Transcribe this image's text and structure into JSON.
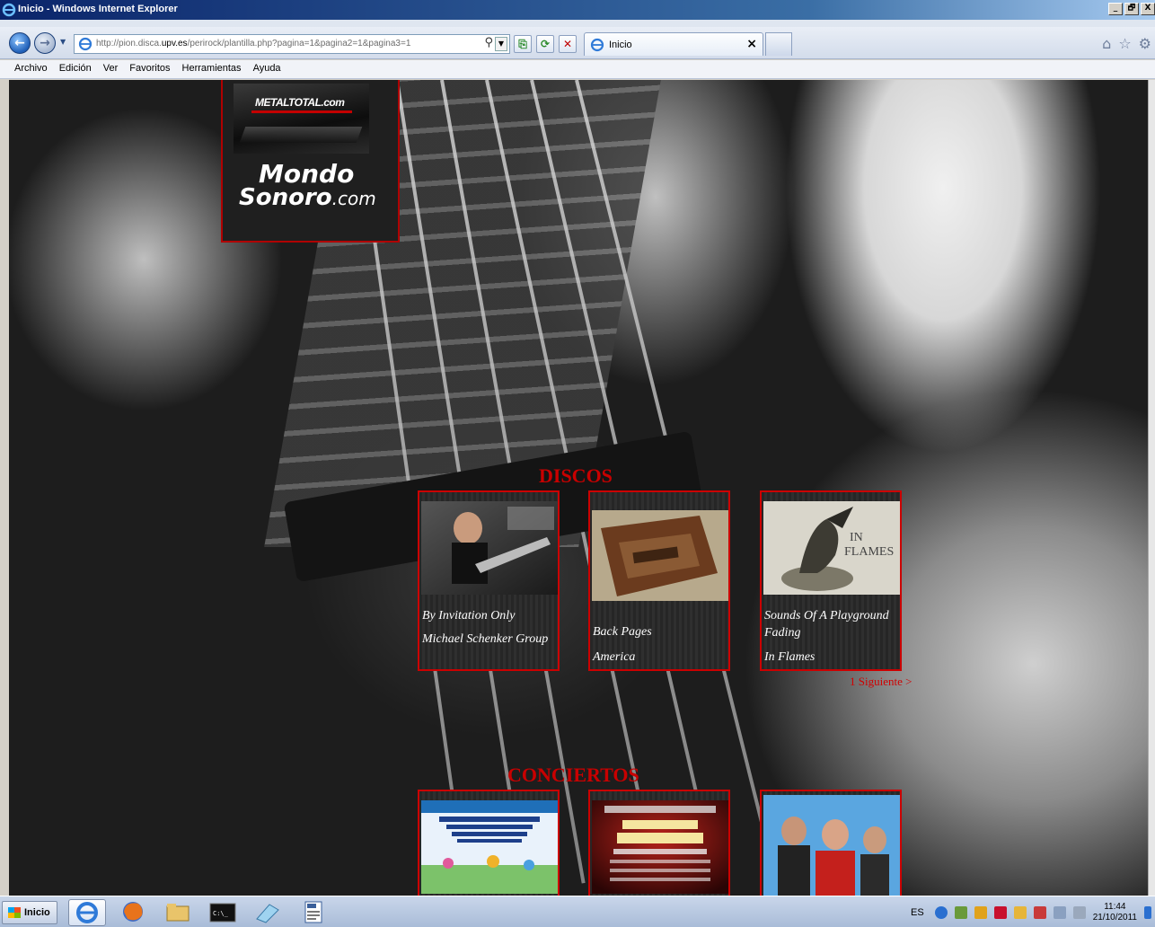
{
  "window": {
    "title": "Inicio - Windows Internet Explorer",
    "buttons": [
      "_",
      "🗗",
      "X"
    ]
  },
  "nav": {
    "back": "←",
    "forward": "→",
    "address_prefix": "http://pion.disca.",
    "address_domain": "upv.es",
    "address_rest": "/perirock/plantilla.php?pagina=1&pagina2=1&pagina3=1",
    "search_symbol": "⚲",
    "tab_label": "Inicio",
    "tab_close": "×"
  },
  "menu": {
    "items": [
      "Archivo",
      "Edición",
      "Ver",
      "Favoritos",
      "Herramientas",
      "Ayuda"
    ]
  },
  "links_panel": {
    "metal_total": "METALTOTAL.com",
    "mondo_line1": "Mondo",
    "mondo_line2": "Sonoro",
    "mondo_com": ".com"
  },
  "discos": {
    "title": "DISCOS",
    "cards": [
      {
        "album": "By Invitation Only",
        "artist": "Michael Schenker Group"
      },
      {
        "album": "Back Pages",
        "artist": "America"
      },
      {
        "album": "Sounds Of A Playground Fading",
        "artist": "In Flames"
      }
    ],
    "pagination": "1 Siguiente >"
  },
  "conciertos": {
    "title": "CONCIERTOS"
  },
  "taskbar": {
    "start_label": "Inicio",
    "lang": "ES",
    "time": "11:44",
    "date": "21/10/2011"
  },
  "colors": {
    "accent_red": "#cc0000",
    "titlebar_blue": "#0a246a"
  }
}
